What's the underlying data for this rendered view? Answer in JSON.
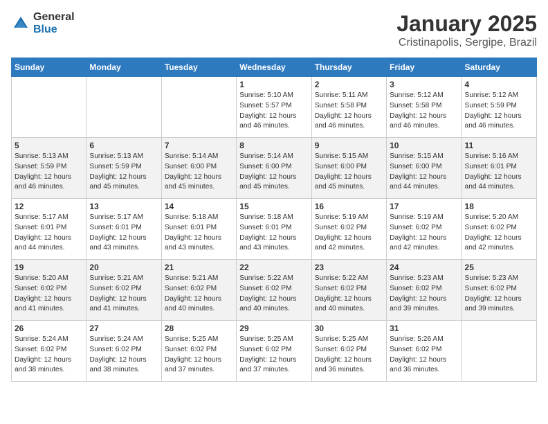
{
  "logo": {
    "general": "General",
    "blue": "Blue"
  },
  "title": "January 2025",
  "subtitle": "Cristinapolis, Sergipe, Brazil",
  "weekdays": [
    "Sunday",
    "Monday",
    "Tuesday",
    "Wednesday",
    "Thursday",
    "Friday",
    "Saturday"
  ],
  "weeks": [
    [
      {
        "day": "",
        "info": ""
      },
      {
        "day": "",
        "info": ""
      },
      {
        "day": "",
        "info": ""
      },
      {
        "day": "1",
        "info": "Sunrise: 5:10 AM\nSunset: 5:57 PM\nDaylight: 12 hours and 46 minutes."
      },
      {
        "day": "2",
        "info": "Sunrise: 5:11 AM\nSunset: 5:58 PM\nDaylight: 12 hours and 46 minutes."
      },
      {
        "day": "3",
        "info": "Sunrise: 5:12 AM\nSunset: 5:58 PM\nDaylight: 12 hours and 46 minutes."
      },
      {
        "day": "4",
        "info": "Sunrise: 5:12 AM\nSunset: 5:59 PM\nDaylight: 12 hours and 46 minutes."
      }
    ],
    [
      {
        "day": "5",
        "info": "Sunrise: 5:13 AM\nSunset: 5:59 PM\nDaylight: 12 hours and 46 minutes."
      },
      {
        "day": "6",
        "info": "Sunrise: 5:13 AM\nSunset: 5:59 PM\nDaylight: 12 hours and 45 minutes."
      },
      {
        "day": "7",
        "info": "Sunrise: 5:14 AM\nSunset: 6:00 PM\nDaylight: 12 hours and 45 minutes."
      },
      {
        "day": "8",
        "info": "Sunrise: 5:14 AM\nSunset: 6:00 PM\nDaylight: 12 hours and 45 minutes."
      },
      {
        "day": "9",
        "info": "Sunrise: 5:15 AM\nSunset: 6:00 PM\nDaylight: 12 hours and 45 minutes."
      },
      {
        "day": "10",
        "info": "Sunrise: 5:15 AM\nSunset: 6:00 PM\nDaylight: 12 hours and 44 minutes."
      },
      {
        "day": "11",
        "info": "Sunrise: 5:16 AM\nSunset: 6:01 PM\nDaylight: 12 hours and 44 minutes."
      }
    ],
    [
      {
        "day": "12",
        "info": "Sunrise: 5:17 AM\nSunset: 6:01 PM\nDaylight: 12 hours and 44 minutes."
      },
      {
        "day": "13",
        "info": "Sunrise: 5:17 AM\nSunset: 6:01 PM\nDaylight: 12 hours and 43 minutes."
      },
      {
        "day": "14",
        "info": "Sunrise: 5:18 AM\nSunset: 6:01 PM\nDaylight: 12 hours and 43 minutes."
      },
      {
        "day": "15",
        "info": "Sunrise: 5:18 AM\nSunset: 6:01 PM\nDaylight: 12 hours and 43 minutes."
      },
      {
        "day": "16",
        "info": "Sunrise: 5:19 AM\nSunset: 6:02 PM\nDaylight: 12 hours and 42 minutes."
      },
      {
        "day": "17",
        "info": "Sunrise: 5:19 AM\nSunset: 6:02 PM\nDaylight: 12 hours and 42 minutes."
      },
      {
        "day": "18",
        "info": "Sunrise: 5:20 AM\nSunset: 6:02 PM\nDaylight: 12 hours and 42 minutes."
      }
    ],
    [
      {
        "day": "19",
        "info": "Sunrise: 5:20 AM\nSunset: 6:02 PM\nDaylight: 12 hours and 41 minutes."
      },
      {
        "day": "20",
        "info": "Sunrise: 5:21 AM\nSunset: 6:02 PM\nDaylight: 12 hours and 41 minutes."
      },
      {
        "day": "21",
        "info": "Sunrise: 5:21 AM\nSunset: 6:02 PM\nDaylight: 12 hours and 40 minutes."
      },
      {
        "day": "22",
        "info": "Sunrise: 5:22 AM\nSunset: 6:02 PM\nDaylight: 12 hours and 40 minutes."
      },
      {
        "day": "23",
        "info": "Sunrise: 5:22 AM\nSunset: 6:02 PM\nDaylight: 12 hours and 40 minutes."
      },
      {
        "day": "24",
        "info": "Sunrise: 5:23 AM\nSunset: 6:02 PM\nDaylight: 12 hours and 39 minutes."
      },
      {
        "day": "25",
        "info": "Sunrise: 5:23 AM\nSunset: 6:02 PM\nDaylight: 12 hours and 39 minutes."
      }
    ],
    [
      {
        "day": "26",
        "info": "Sunrise: 5:24 AM\nSunset: 6:02 PM\nDaylight: 12 hours and 38 minutes."
      },
      {
        "day": "27",
        "info": "Sunrise: 5:24 AM\nSunset: 6:02 PM\nDaylight: 12 hours and 38 minutes."
      },
      {
        "day": "28",
        "info": "Sunrise: 5:25 AM\nSunset: 6:02 PM\nDaylight: 12 hours and 37 minutes."
      },
      {
        "day": "29",
        "info": "Sunrise: 5:25 AM\nSunset: 6:02 PM\nDaylight: 12 hours and 37 minutes."
      },
      {
        "day": "30",
        "info": "Sunrise: 5:25 AM\nSunset: 6:02 PM\nDaylight: 12 hours and 36 minutes."
      },
      {
        "day": "31",
        "info": "Sunrise: 5:26 AM\nSunset: 6:02 PM\nDaylight: 12 hours and 36 minutes."
      },
      {
        "day": "",
        "info": ""
      }
    ]
  ]
}
